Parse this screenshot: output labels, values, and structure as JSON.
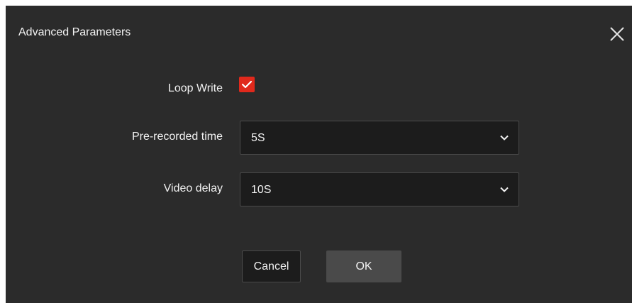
{
  "dialog": {
    "title": "Advanced Parameters",
    "close_icon": "close-icon"
  },
  "fields": {
    "loop_write": {
      "label": "Loop Write",
      "checked": true
    },
    "pre_recorded_time": {
      "label": "Pre-recorded time",
      "value": "5S"
    },
    "video_delay": {
      "label": "Video delay",
      "value": "10S"
    }
  },
  "buttons": {
    "cancel": "Cancel",
    "ok": "OK"
  },
  "colors": {
    "background": "#2b2b2b",
    "checkbox_accent": "#e0291c",
    "input_background": "#1c1c1c",
    "ok_button": "#4a4a4a"
  }
}
